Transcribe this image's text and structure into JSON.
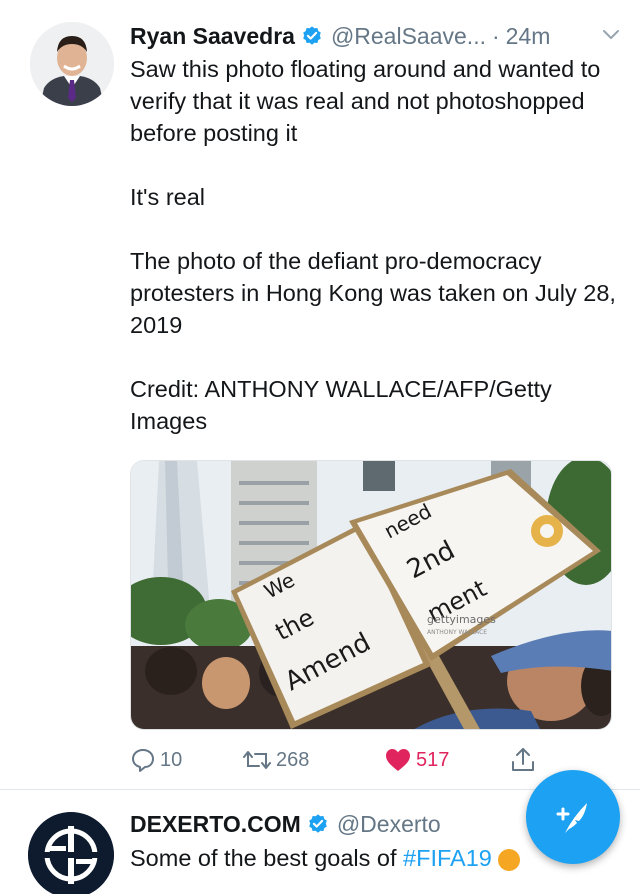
{
  "tweet": {
    "display_name": "Ryan Saavedra",
    "handle": "@RealSaave...",
    "separator": "·",
    "time": "24m",
    "paragraphs": [
      "Saw this photo floating around and wanted to verify that it was real and not photoshopped before posting it",
      "It's real",
      "The photo of the defiant pro-democracy protesters in Hong Kong was taken on July 28, 2019",
      "Credit: ANTHONY WALLACE/AFP/Getty Images"
    ],
    "media": {
      "sign_left": [
        "We",
        "the",
        "Amend"
      ],
      "sign_right": [
        "need",
        "2nd",
        "ment"
      ],
      "watermark": "gettyimages",
      "watermark_credit": "ANTHONY WALLACE"
    },
    "actions": {
      "reply_count": "10",
      "retweet_count": "268",
      "like_count": "517"
    }
  },
  "next_tweet": {
    "display_name": "DEXERTO.COM",
    "handle": "@Dexerto",
    "text_prefix": "Some of the best goals of ",
    "hashtag": "#FIFA19"
  },
  "colors": {
    "accent": "#1da1f2",
    "like": "#e0245e",
    "secondary_text": "#657786"
  },
  "icons": [
    "verified-badge-icon",
    "chevron-down-icon",
    "reply-icon",
    "retweet-icon",
    "heart-icon",
    "share-icon",
    "compose-tweet-icon"
  ]
}
